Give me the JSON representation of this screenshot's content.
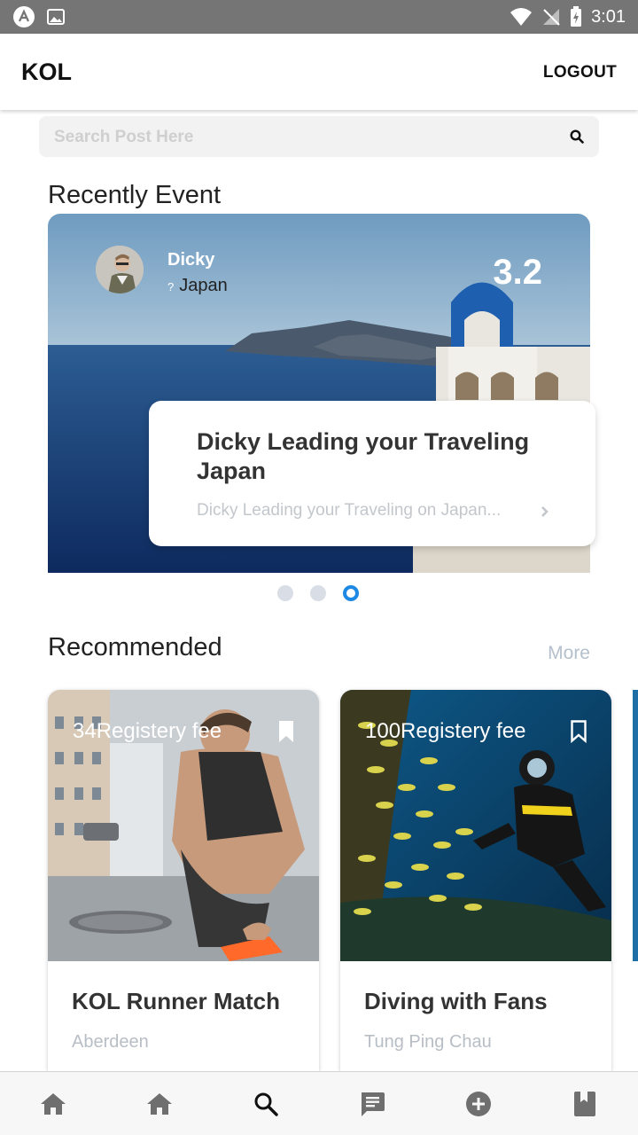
{
  "status_bar": {
    "time": "3:01"
  },
  "app_bar": {
    "title": "KOL",
    "logout_label": "LOGOUT"
  },
  "search": {
    "placeholder": "Search Post Here"
  },
  "recent_events": {
    "title": "Recently Event",
    "card": {
      "host_name": "Dicky",
      "location_marker": "?",
      "location": "Japan",
      "rating": "3.2",
      "event_title": "Dicky Leading your Traveling Japan",
      "event_description": "Dicky Leading your Traveling on Japan..."
    },
    "pagination": {
      "count": 3,
      "active_index": 2
    }
  },
  "recommended": {
    "title": "Recommended",
    "more_label": "More",
    "items": [
      {
        "fee": "34Registery fee",
        "name": "KOL Runner Match",
        "place": "Aberdeen",
        "bookmarked": true
      },
      {
        "fee": "100Registery fee",
        "name": "Diving with Fans",
        "place": "Tung Ping Chau",
        "bookmarked": false
      }
    ]
  },
  "bottom_nav": {
    "items": [
      {
        "icon": "home-icon"
      },
      {
        "icon": "home-icon"
      },
      {
        "icon": "search-icon"
      },
      {
        "icon": "message-icon"
      },
      {
        "icon": "add-circle-icon"
      },
      {
        "icon": "book-icon"
      }
    ],
    "active_index": 2
  },
  "colors": {
    "accent": "#1e88e5",
    "status_bar": "#757575",
    "icon_gray": "#6f6f6f",
    "muted_text": "#b8bec5"
  }
}
